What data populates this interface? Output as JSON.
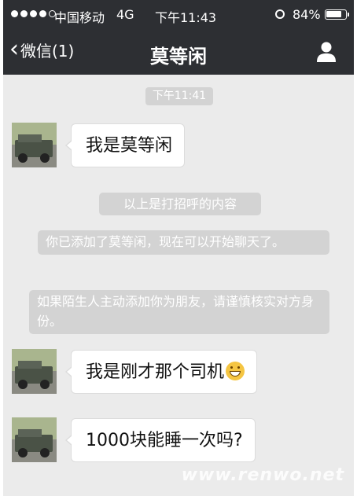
{
  "status_bar": {
    "carrier": "中国移动",
    "network": "4G",
    "time": "下午11:43",
    "battery": "84%",
    "battery_level": 0.84,
    "signal_bars_filled": 4,
    "signal_bars_total": 5
  },
  "nav": {
    "back_label": "微信(1)",
    "title": "莫等闲"
  },
  "chat": {
    "timestamp": "下午11:41",
    "messages": [
      {
        "type": "incoming",
        "text": "我是莫等闲"
      },
      {
        "type": "system",
        "text": "以上是打招呼的内容"
      },
      {
        "type": "system",
        "text": "你已添加了莫等闲，现在可以开始聊天了。"
      },
      {
        "type": "system",
        "text": "如果陌生人主动添加你为朋友，请谨慎核实对方身份。"
      },
      {
        "type": "incoming",
        "text": "我是刚才那个司机",
        "emoji": "grinning-face"
      },
      {
        "type": "incoming",
        "text": "1000块能睡一次吗?"
      }
    ]
  },
  "watermark": "www.renwo.net",
  "colors": {
    "nav_background": "#2d2f33",
    "chat_background": "#ebebeb",
    "system_bubble": "#d3d3d3",
    "incoming_bubble": "#ffffff"
  }
}
